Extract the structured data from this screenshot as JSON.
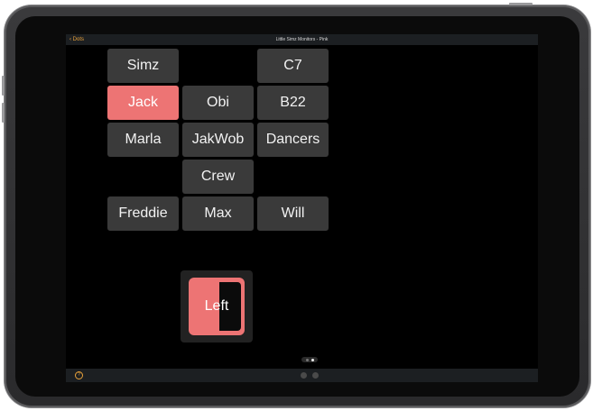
{
  "navbar": {
    "back_label": "‹ Dots",
    "title": "Little Simz Monitors - Pink"
  },
  "tiles": [
    {
      "label": "Simz",
      "active": false
    },
    {
      "label": "C7",
      "active": false
    },
    {
      "label": "Jack",
      "active": true
    },
    {
      "label": "Obi",
      "active": false
    },
    {
      "label": "B22",
      "active": false
    },
    {
      "label": "Marla",
      "active": false
    },
    {
      "label": "JakWob",
      "active": false
    },
    {
      "label": "Dancers",
      "active": false
    },
    {
      "label": "Crew",
      "active": false
    },
    {
      "label": "Freddie",
      "active": false
    },
    {
      "label": "Max",
      "active": false
    },
    {
      "label": "Will",
      "active": false
    }
  ],
  "control": {
    "label": "Left"
  },
  "page_indicator": {
    "pages": 2,
    "current": 2
  },
  "bottombar": {
    "help_icon": "help-icon",
    "page_count": 2
  },
  "colors": {
    "accent": "#e9a23b",
    "active_tile": "#ed7474",
    "tile": "#3a3a3a"
  }
}
